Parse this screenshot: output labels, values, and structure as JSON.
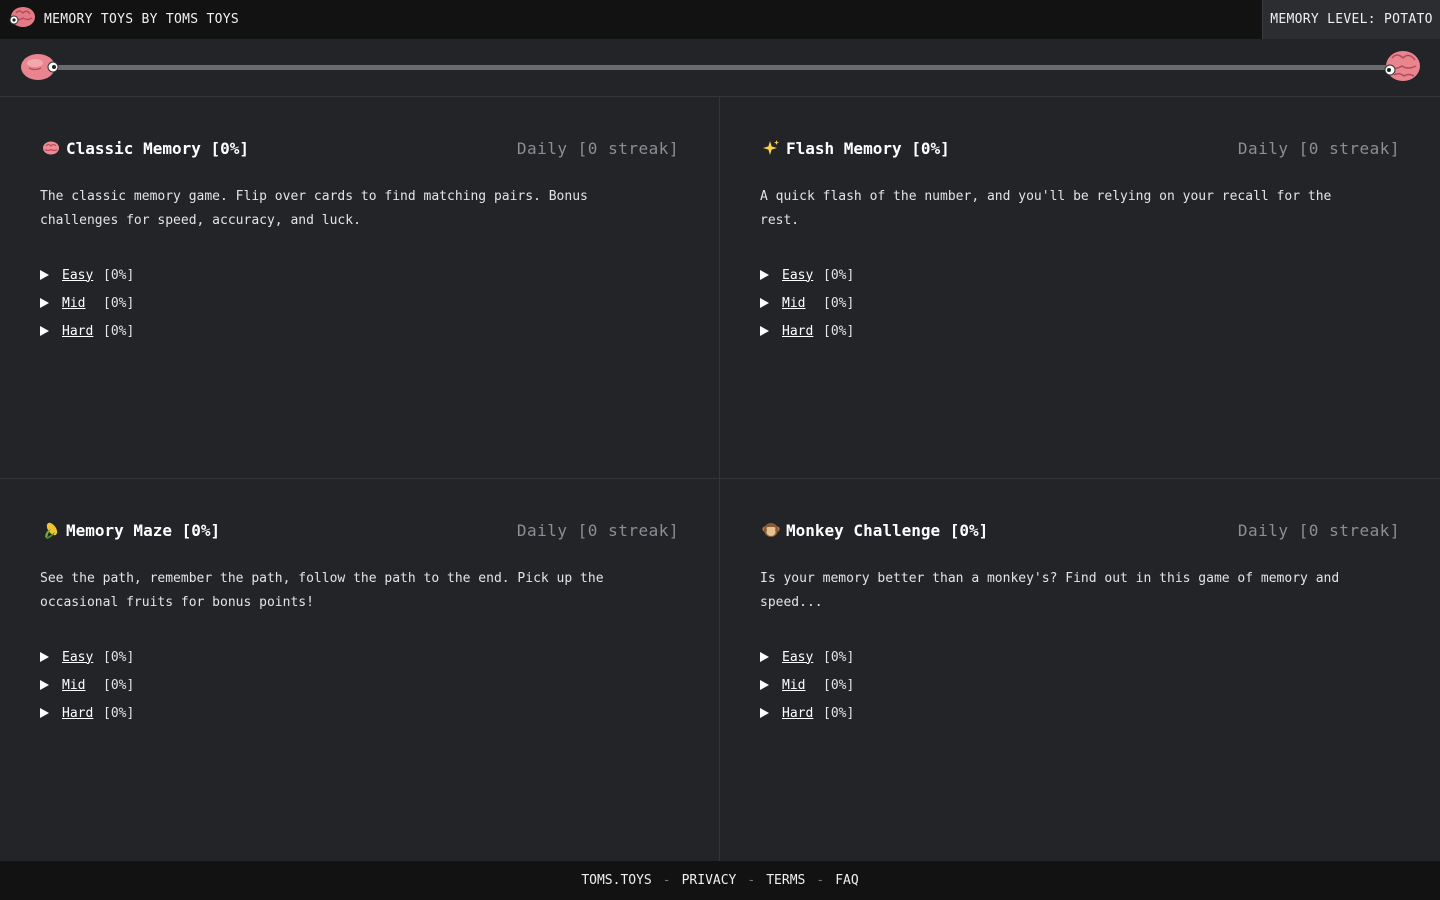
{
  "header": {
    "brand": "MEMORY TOYS BY TOMS TOYS",
    "memory_level": "MEMORY LEVEL: POTATO"
  },
  "progress": {
    "value": 0
  },
  "games": [
    {
      "emoji": "brain",
      "title": "Classic Memory",
      "pct": "[0%]",
      "daily": "Daily [0 streak]",
      "description": "The classic memory game. Flip over cards to find matching pairs. Bonus challenges for speed, accuracy, and luck.",
      "levels": [
        {
          "name": "Easy",
          "pct": "[0%]"
        },
        {
          "name": "Mid",
          "pct": "[0%]"
        },
        {
          "name": "Hard",
          "pct": "[0%]"
        }
      ]
    },
    {
      "emoji": "sparkles",
      "title": "Flash Memory",
      "pct": "[0%]",
      "daily": "Daily [0 streak]",
      "description": "A quick flash of the number, and you'll be relying on your recall for the rest.",
      "levels": [
        {
          "name": "Easy",
          "pct": "[0%]"
        },
        {
          "name": "Mid",
          "pct": "[0%]"
        },
        {
          "name": "Hard",
          "pct": "[0%]"
        }
      ]
    },
    {
      "emoji": "corn",
      "title": "Memory Maze",
      "pct": "[0%]",
      "daily": "Daily [0 streak]",
      "description": "See the path, remember the path, follow the path to the end. Pick up the occasional fruits for bonus points!",
      "levels": [
        {
          "name": "Easy",
          "pct": "[0%]"
        },
        {
          "name": "Mid",
          "pct": "[0%]"
        },
        {
          "name": "Hard",
          "pct": "[0%]"
        }
      ]
    },
    {
      "emoji": "monkey",
      "title": "Monkey Challenge",
      "pct": "[0%]",
      "daily": "Daily [0 streak]",
      "description": "Is your memory better than a monkey's? Find out in this game of memory and speed...",
      "levels": [
        {
          "name": "Easy",
          "pct": "[0%]"
        },
        {
          "name": "Mid",
          "pct": "[0%]"
        },
        {
          "name": "Hard",
          "pct": "[0%]"
        }
      ]
    }
  ],
  "footer": {
    "links": [
      "TOMS.TOYS",
      "PRIVACY",
      "TERMS",
      "FAQ"
    ],
    "separator": "-"
  }
}
